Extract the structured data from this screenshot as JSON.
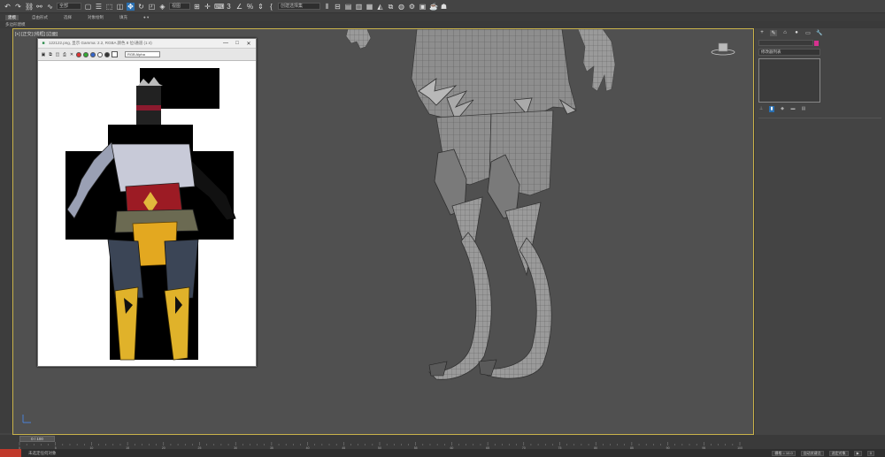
{
  "toolbar": {
    "icons": [
      "undo-icon",
      "redo-icon",
      "link-icon",
      "unlink-icon",
      "bind-spacewarp-icon"
    ],
    "selection_filter": "全部",
    "selection_filter2": "视图",
    "named_selection": "创建选择集"
  },
  "ribbon": {
    "tabs": [
      "建模",
      "自由形式",
      "选择",
      "对象绘制",
      "填充"
    ],
    "active_tab": "建模",
    "sub_label": "多边形建模"
  },
  "viewport": {
    "label": "[+] [正交] [线框] [边面]"
  },
  "image_window": {
    "title": "122122.png, 显示 Gamma: 2.2, RGBA 颜色 8 位/通道 (1:4)",
    "channel": "RGB Alpha",
    "controls": {
      "minimize": "—",
      "maximize": "□",
      "close": "✕"
    }
  },
  "command_panel": {
    "tabs": [
      "+",
      "✎",
      "⌂",
      "●",
      "▭",
      "🔧"
    ],
    "modifier_list": "修改器列表"
  },
  "timeline": {
    "frame_display": "0 / 100",
    "ticks": [
      "0",
      "5",
      "10",
      "15",
      "20",
      "25",
      "30",
      "35",
      "40",
      "45",
      "50",
      "55",
      "60",
      "65",
      "70",
      "75",
      "80",
      "85",
      "90",
      "95",
      "100"
    ]
  },
  "status": {
    "text": "未选定任何对象",
    "grid": "栅格 = 10.0",
    "key_mode": "选定对象",
    "auto_key": "自动关键点"
  },
  "colors": {
    "accent": "#2a6fb0",
    "viewport_border": "#c9b24a",
    "swatch": "#d6318f"
  }
}
